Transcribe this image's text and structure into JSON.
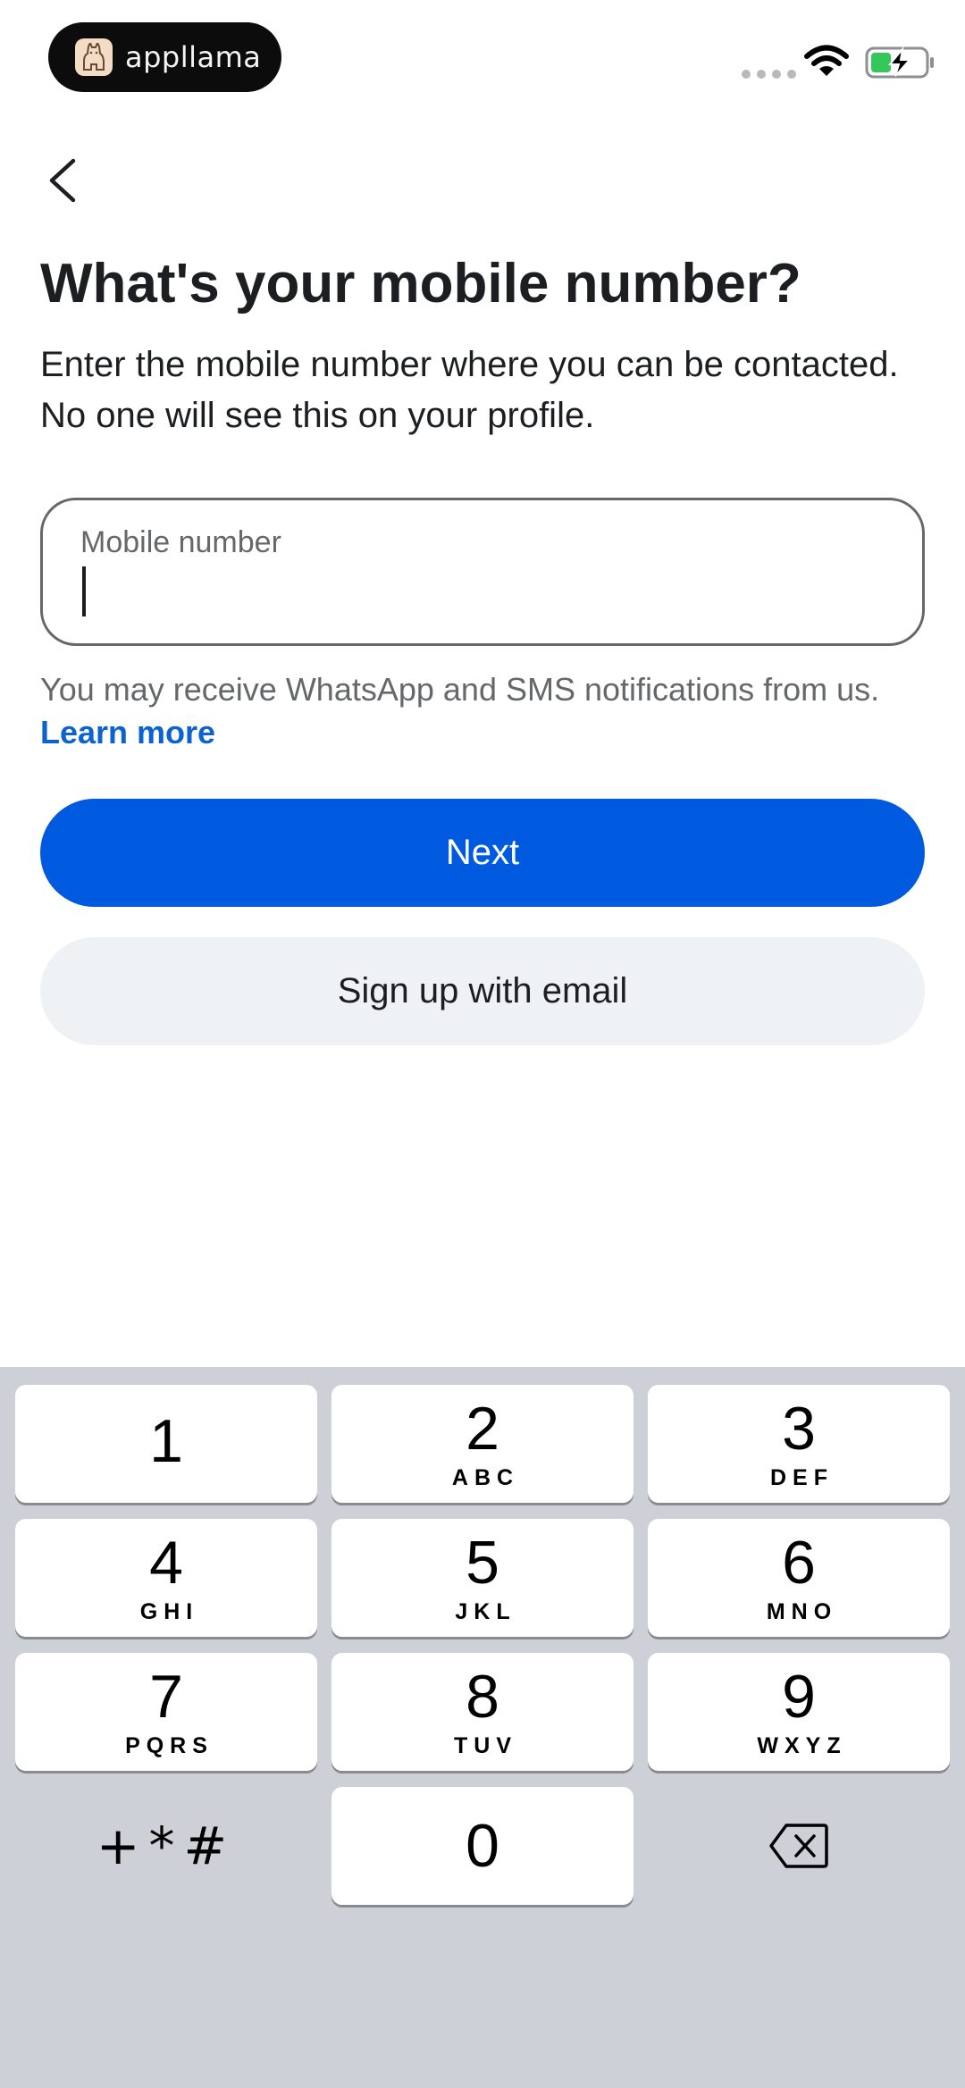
{
  "status_bar": {
    "app_name": "appllama",
    "icons": [
      "signal-dots-icon",
      "wifi-icon",
      "battery-charging-icon"
    ],
    "battery_color": "#34c759"
  },
  "header": {
    "back_icon": "chevron-left-icon"
  },
  "main": {
    "title": "What's your mobile number?",
    "subtitle": "Enter the mobile number where you can be contacted. No one will see this on your profile.",
    "mobile_input": {
      "label": "Mobile number",
      "value": ""
    },
    "notice_text": "You may receive WhatsApp and SMS notifications from us.",
    "notice_link": "Learn more",
    "next_label": "Next",
    "email_label": "Sign up with email"
  },
  "colors": {
    "primary": "#005ae0",
    "link": "#0a63d1",
    "secondary_button": "#eff2f5",
    "keypad_bg": "#cdd0d6"
  },
  "keypad": {
    "keys": [
      {
        "num": "1",
        "letters": ""
      },
      {
        "num": "2",
        "letters": "ABC"
      },
      {
        "num": "3",
        "letters": "DEF"
      },
      {
        "num": "4",
        "letters": "GHI"
      },
      {
        "num": "5",
        "letters": "JKL"
      },
      {
        "num": "6",
        "letters": "MNO"
      },
      {
        "num": "7",
        "letters": "PQRS"
      },
      {
        "num": "8",
        "letters": "TUV"
      },
      {
        "num": "9",
        "letters": "WXYZ"
      },
      {
        "num": "0",
        "letters": ""
      }
    ],
    "symbols": "+*#",
    "delete_icon": "backspace-icon"
  }
}
